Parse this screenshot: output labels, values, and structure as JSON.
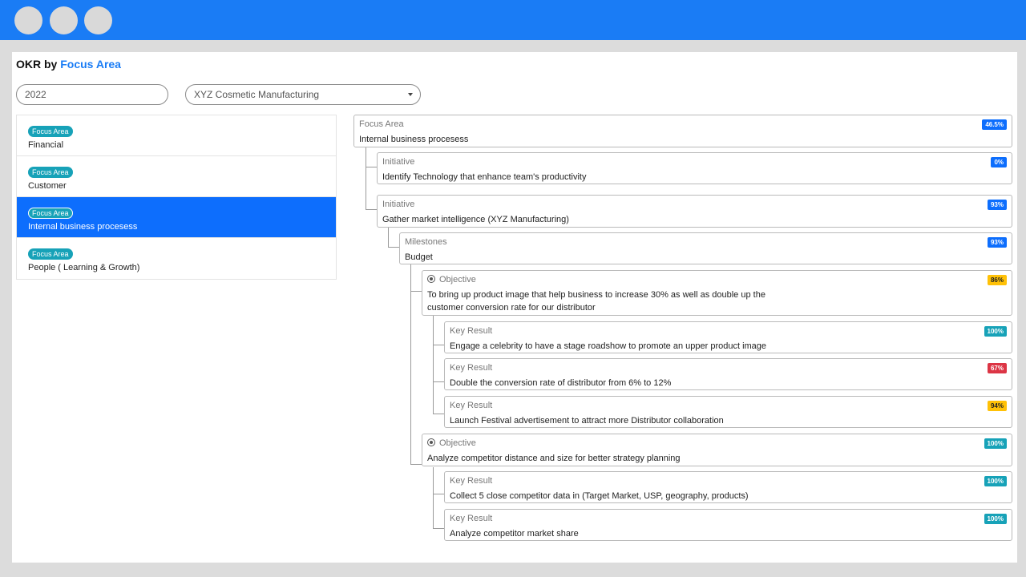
{
  "window": {
    "dots": [
      "window-dot",
      "window-dot",
      "window-dot"
    ]
  },
  "header": {
    "title_prefix": "OKR by",
    "title_accent": "Focus Area"
  },
  "filters": {
    "year": "2022",
    "company": "XYZ Cosmetic Manufacturing"
  },
  "focus_areas": [
    {
      "badge": "Focus Area",
      "label": "Financial",
      "active": false
    },
    {
      "badge": "Focus Area",
      "label": "Customer",
      "active": false
    },
    {
      "badge": "Focus Area",
      "label": "Internal business procesess",
      "active": true
    },
    {
      "badge": "Focus Area",
      "label": "People ( Learning & Growth)",
      "active": false
    }
  ],
  "tree": {
    "focus_area": {
      "type": "Focus Area",
      "title": "Internal business procesess",
      "pct": "46.5%"
    },
    "initiative1": {
      "type": "Initiative",
      "title": "Identify Technology that enhance team's productivity",
      "pct": "0%"
    },
    "initiative2": {
      "type": "Initiative",
      "title": "Gather market intelligence (XYZ Manufacturing)",
      "pct": "93%"
    },
    "milestone": {
      "type": "Milestones",
      "title": "Budget",
      "pct": "93%"
    },
    "objective1": {
      "type": "Objective",
      "title_line1": "To bring up product image that help business to increase 30% as well as double up the",
      "title_line2": "customer conversion rate for our distributor",
      "pct": "86%"
    },
    "kr1": {
      "type": "Key Result",
      "title": "Engage a celebrity to have a stage roadshow to promote an upper product image",
      "pct": "100%"
    },
    "kr2": {
      "type": "Key Result",
      "title": "Double the conversion rate of distributor from 6% to 12%",
      "pct": "67%"
    },
    "kr3": {
      "type": "Key Result",
      "title": "Launch Festival advertisement to attract more Distributor collaboration",
      "pct": "94%"
    },
    "objective2": {
      "type": "Objective",
      "title": "Analyze competitor distance and size for better strategy planning",
      "pct": "100%"
    },
    "kr4": {
      "type": "Key Result",
      "title": "Collect 5 close competitor data in (Target Market, USP, geography, products)",
      "pct": "100%"
    },
    "kr5": {
      "type": "Key Result",
      "title": "Analyze competitor market share",
      "pct": "100%"
    }
  },
  "colors": {
    "titlebar": "#1a7cf5",
    "active_item": "#0d6efd",
    "badge_teal": "#17a2b8",
    "badge_blue": "#0d6efd",
    "badge_yellow": "#ffc107",
    "badge_red": "#dc3545"
  }
}
